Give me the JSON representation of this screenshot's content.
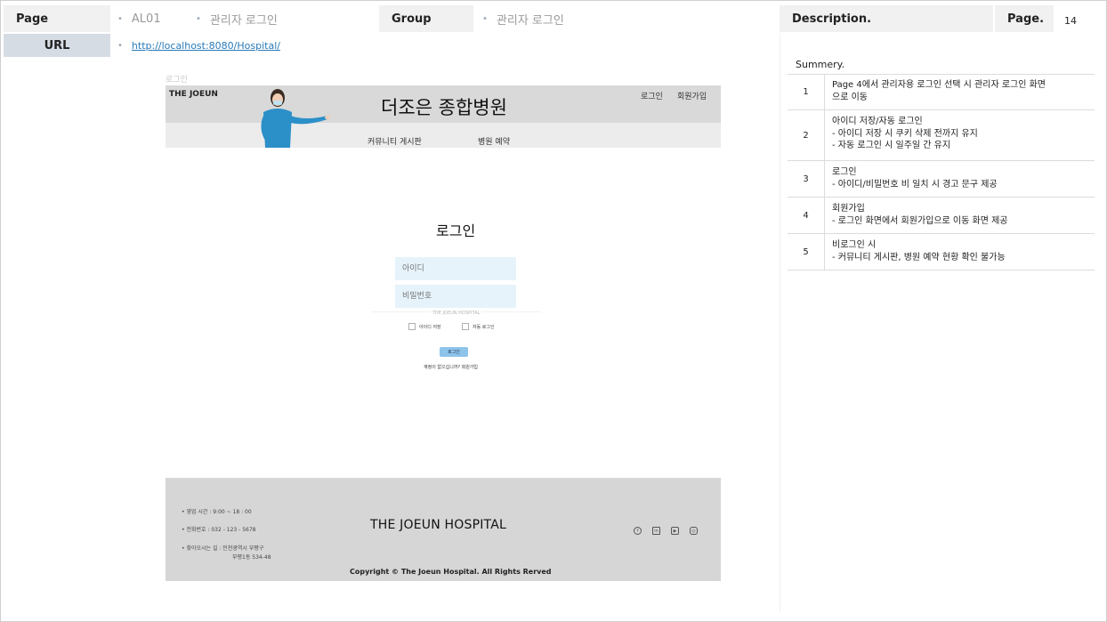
{
  "header": {
    "page_label": "Page",
    "page_code": "AL01",
    "page_name": "관리자 로그인",
    "group_label": "Group",
    "group_name": "관리자 로그인",
    "description_label": "Description.",
    "page_no_label": "Page.",
    "page_no": "14",
    "url_label": "URL",
    "url": "http://localhost:8080/Hospital/"
  },
  "mock": {
    "breadcrumb": "로그인",
    "brand": "THE JOEUN",
    "title": "더조은 종합병원",
    "top_links": [
      "로그인",
      "회원가입"
    ],
    "nav": [
      "커뮤니티 게시판",
      "병원 예약"
    ],
    "login_title": "로그인",
    "id_placeholder": "아이디",
    "pw_placeholder": "비밀번호",
    "hospital_small": "THE JOEUN HOSPITAL",
    "save_id": "아이디 저장",
    "auto_login": "자동 로그인",
    "login_button": "로그인",
    "signup_hint": "계정이 없으십니까? 회원가입",
    "footer": {
      "hours": "• 영업 시간 : 9:00 ~ 18 : 00",
      "phone": "• 전화번호 : 032 - 123 - 5678",
      "address1": "• 찾아오시는 길 : 인천광역시 부평구",
      "address2": "부평1동 534-48",
      "brand": "THE JOEUN HOSPITAL",
      "copyright": "Copyright © The Joeun Hospital. All Rights Rerved"
    }
  },
  "summary": {
    "title": "Summery.",
    "rows": [
      {
        "num": "1",
        "text": "Page 4에서 관리자용 로그인 선택 시 관리자 로그인 화면\n으로 이동"
      },
      {
        "num": "2",
        "text": "아이디 저장/자동 로그인\n-    아이디 저장 시 쿠키 삭제 전까지 유지\n-    자동 로그인 시 일주일 간 유지"
      },
      {
        "num": "3",
        "text": "로그인\n-    아이디/비밀번호 비 일치 시 경고 문구 제공"
      },
      {
        "num": "4",
        "text": "회원가입\n- 로그인 화면에서 회원가입으로 이동 화면 제공"
      },
      {
        "num": "5",
        "text": "비로그인 시\n-    커뮤니티 게시판, 병원 예약 현황 확인 불가능"
      }
    ]
  },
  "icons": [
    "facebook-icon",
    "linkedin-icon",
    "youtube-icon",
    "instagram-icon"
  ]
}
